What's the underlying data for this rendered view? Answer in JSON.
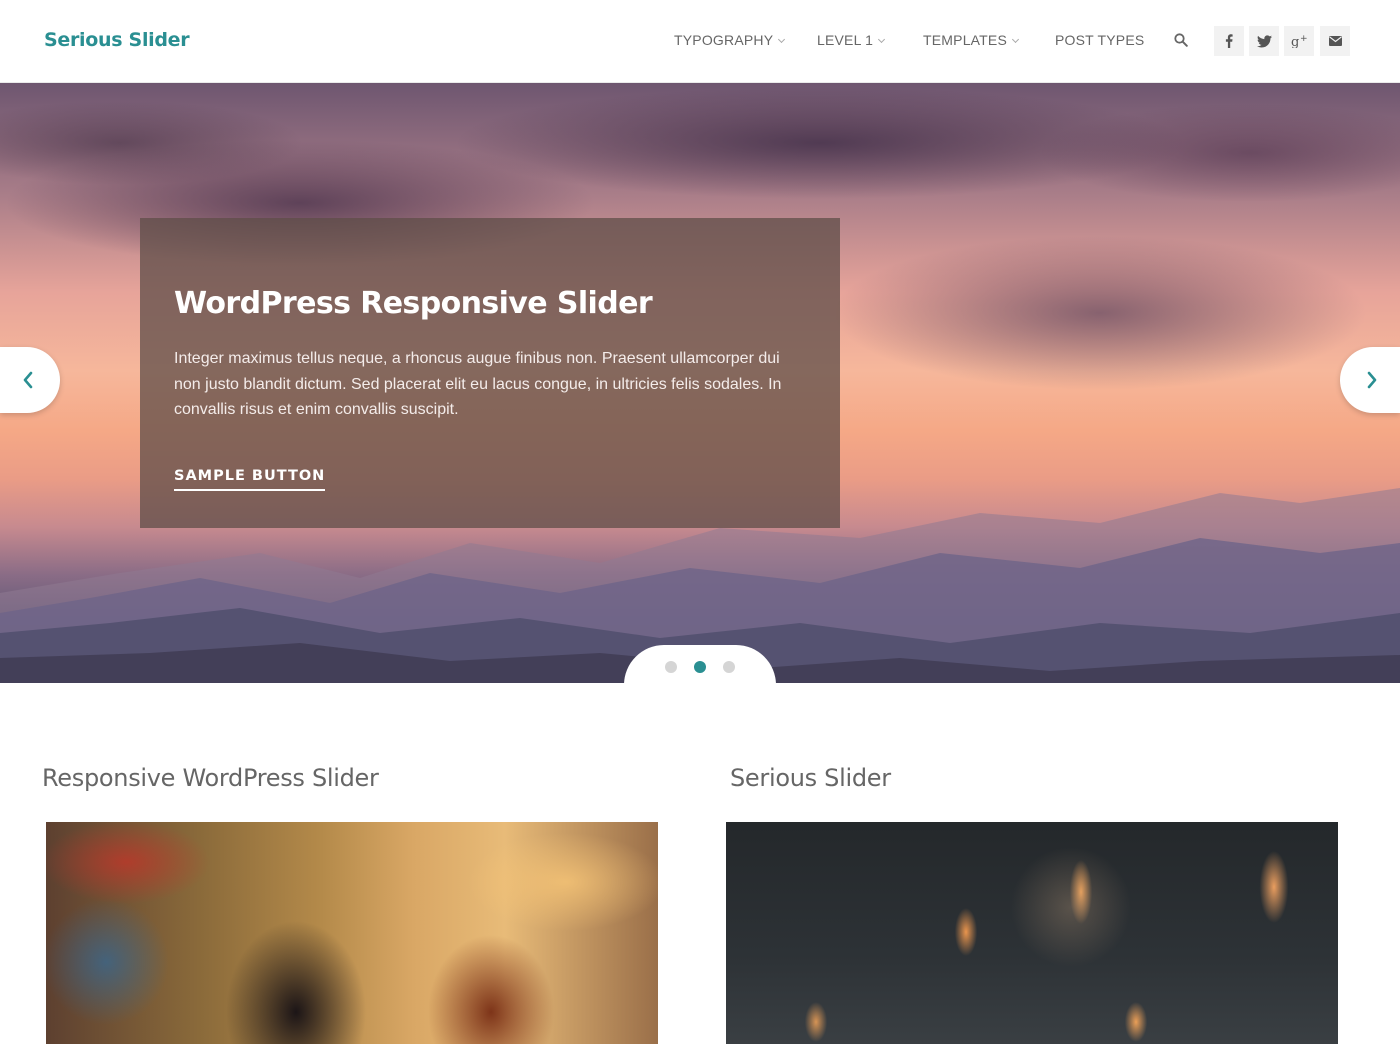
{
  "site": {
    "logo": "Serious Slider"
  },
  "nav": {
    "items": [
      {
        "label": "TYPOGRAPHY",
        "has_dropdown": true
      },
      {
        "label": "LEVEL 1",
        "has_dropdown": true
      },
      {
        "label": "TEMPLATES",
        "has_dropdown": true
      },
      {
        "label": "POST TYPES",
        "has_dropdown": false
      }
    ],
    "search_icon": "search-icon",
    "social": [
      "facebook-icon",
      "twitter-icon",
      "google-plus-icon",
      "email-icon"
    ]
  },
  "slider": {
    "title": "WordPress Responsive Slider",
    "text": "Integer maximus tellus neque, a rhoncus augue finibus non. Praesent ullamcorper dui non justo blandit dictum. Sed placerat elit eu lacus congue, in ultricies felis sodales. In convallis risus et enim convallis suscipit.",
    "button": "SAMPLE BUTTON",
    "prev_icon": "chevron-left-icon",
    "next_icon": "chevron-right-icon",
    "slide_count": 3,
    "active_slide": 2
  },
  "posts": [
    {
      "title": "Responsive WordPress Slider"
    },
    {
      "title": "Serious Slider"
    }
  ],
  "colors": {
    "accent": "#2a8f92",
    "text": "#666666"
  }
}
